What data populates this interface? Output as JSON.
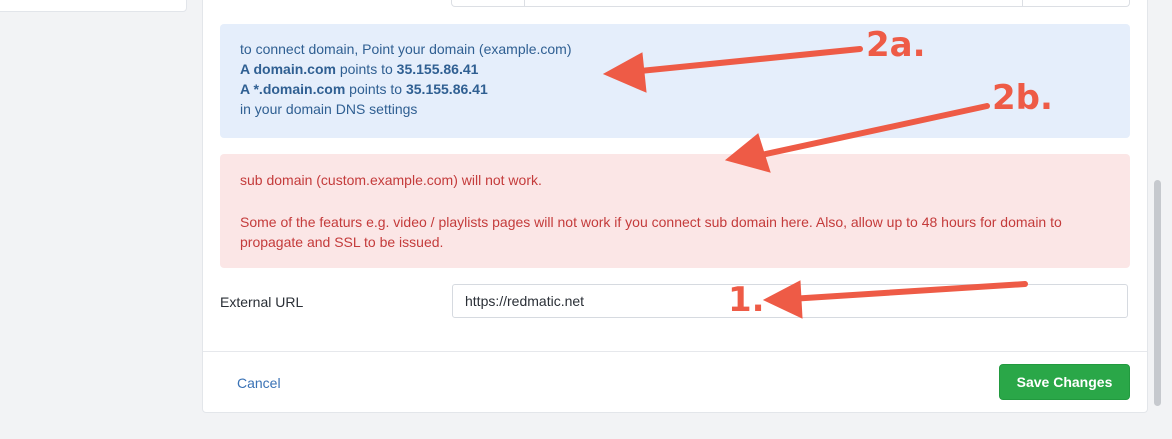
{
  "info_box": {
    "line1": "to connect domain, Point your domain (example.com)",
    "line2_prefix": "A ",
    "line2_domain": "domain.com",
    "line2_mid": " points to ",
    "line2_ip": "35.155.86.41",
    "line3_prefix": "A ",
    "line3_domain": "*.domain.com",
    "line3_mid": " points to ",
    "line3_ip": "35.155.86.41",
    "line4": "in your domain DNS settings"
  },
  "warning_box": {
    "line1": "sub domain (custom.example.com) will not work.",
    "line2": "Some of the featurs e.g. video / playlists pages will not work if you connect sub domain here. Also, allow up to 48 hours for domain to propagate and SSL to be issued."
  },
  "external_url": {
    "label": "External URL",
    "value": "https://redmatic.net"
  },
  "footer": {
    "cancel_label": "Cancel",
    "save_label": "Save Changes"
  },
  "annotations": {
    "label_2a": "2a.",
    "label_2b": "2b.",
    "label_1": "1."
  },
  "colors": {
    "annotation": "#ee5b46",
    "save_button": "#2aa748",
    "info_bg": "#e5eefb",
    "warning_bg": "#fbe6e6"
  }
}
